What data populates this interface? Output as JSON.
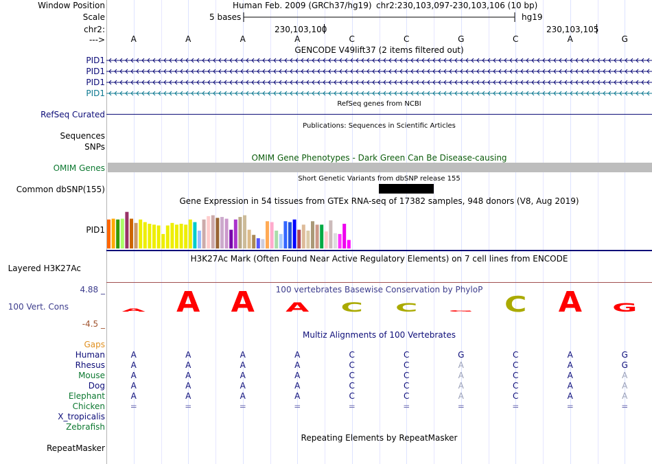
{
  "header": {
    "window_position_label": "Window Position",
    "scale_label": "Scale",
    "chrom_label": "chr2:",
    "arrow_label": "--->",
    "assembly": "Human Feb. 2009 (GRCh37/hg19)",
    "position": "chr2:230,103,097-230,103,106 (10 bp)",
    "scale_text": "5 bases",
    "db": "hg19",
    "coord1": "230,103,100",
    "coord2": "230,103,105"
  },
  "bases": [
    "A",
    "A",
    "A",
    "A",
    "C",
    "C",
    "G",
    "C",
    "A",
    "G"
  ],
  "gencode": {
    "title": "GENCODE V49lift37 (2 items filtered out)",
    "items": [
      "PID1",
      "PID1",
      "PID1",
      "PID1"
    ],
    "colors": [
      "#0c0c78",
      "#0c0c78",
      "#0c0c78",
      "#0c7890"
    ]
  },
  "refseq": {
    "label": "RefSeq Curated",
    "title": "RefSeq genes from NCBI"
  },
  "publications": {
    "title": "Publications: Sequences in Scientific Articles",
    "label1": "Sequences",
    "label2": "SNPs"
  },
  "omim": {
    "title": "OMIM Gene Phenotypes - Dark Green Can Be Disease-causing",
    "label": "OMIM Genes"
  },
  "dbsnp": {
    "title": "Short Genetic Variants from dbSNP release 155",
    "label": "Common dbSNP(155)"
  },
  "gtex": {
    "title": "Gene Expression in 54 tissues from GTEx RNA-seq of 17382 samples, 948 donors (V8, Aug 2019)",
    "label": "PID1",
    "values": [
      0.68,
      0.7,
      0.68,
      0.7,
      0.86,
      0.7,
      0.6,
      0.68,
      0.62,
      0.58,
      0.56,
      0.54,
      0.34,
      0.54,
      0.6,
      0.56,
      0.58,
      0.56,
      0.68,
      0.62,
      0.42,
      0.68,
      0.76,
      0.78,
      0.72,
      0.74,
      0.7,
      0.44,
      0.68,
      0.74,
      0.78,
      0.44,
      0.32,
      0.24,
      0.22,
      0.64,
      0.62,
      0.42,
      0.34,
      0.64,
      0.62,
      0.68,
      0.44,
      0.56,
      0.42,
      0.64,
      0.56,
      0.56,
      0.4,
      0.66,
      0.36,
      0.34,
      0.58,
      0.2
    ],
    "colors": [
      "#ff6600",
      "#ffaa00",
      "#339900",
      "#aaff66",
      "#993366",
      "#cc6600",
      "#cc9966",
      "#eeee00",
      "#eeee00",
      "#eeee00",
      "#eeee00",
      "#eeee00",
      "#eeee00",
      "#eeee00",
      "#eeee00",
      "#eeee00",
      "#eeee00",
      "#eeee00",
      "#eeee00",
      "#00cccc",
      "#99bbff",
      "#ccaaaa",
      "#ffcccc",
      "#ccaaaa",
      "#996633",
      "#ccaacc",
      "#cc99cc",
      "#7700aa",
      "#aa33cc",
      "#bbaa88",
      "#ccbb99",
      "#ddbb88",
      "#aa8855",
      "#5555ff",
      "#ccccdd",
      "#ffaa55",
      "#ffaacc",
      "#aaddaa",
      "#aaccff",
      "#3366ff",
      "#2255dd",
      "#0000ff",
      "#aa4455",
      "#ddbb99",
      "#ddccaa",
      "#aa9977",
      "#cc9988",
      "#00aa44",
      "#ffcccc",
      "#ccbbbb",
      "#dddddd",
      "#ff33ff",
      "#ee00ee",
      "#ff00ff"
    ]
  },
  "h3k27ac": {
    "title": "H3K27Ac Mark (Often Found Near Active Regulatory Elements) on 7 cell lines from ENCODE",
    "label": "Layered H3K27Ac"
  },
  "cons": {
    "title": "100 vertebrates Basewise Conservation by PhyloP",
    "label": "100 Vert. Cons",
    "max": "4.88 _",
    "min": "-4.5 _",
    "scores": [
      0.15,
      1.0,
      1.0,
      0.45,
      0.45,
      0.4,
      0.05,
      0.75,
      1.0,
      0.4
    ],
    "colors": [
      "#ff0000",
      "#ff0000",
      "#ff0000",
      "#ff0000",
      "#aaaa00",
      "#aaaa00",
      "#ff0000",
      "#aaaa00",
      "#ff0000",
      "#ff0000"
    ]
  },
  "multiz": {
    "title": "Multiz Alignments of 100 Vertebrates",
    "gaps_label": "Gaps",
    "species": [
      {
        "name": "Human",
        "bases": [
          "A",
          "A",
          "A",
          "A",
          "C",
          "C",
          "G",
          "C",
          "A",
          "G"
        ],
        "color": "#0c0c78"
      },
      {
        "name": "Rhesus",
        "bases": [
          "A",
          "A",
          "A",
          "A",
          "C",
          "C",
          "A",
          "C",
          "A",
          "G"
        ],
        "color": "#0c0c78"
      },
      {
        "name": "Mouse",
        "bases": [
          "A",
          "A",
          "A",
          "A",
          "C",
          "C",
          "A",
          "C",
          "A",
          "A"
        ],
        "color": "#0c7830"
      },
      {
        "name": "Dog",
        "bases": [
          "A",
          "A",
          "A",
          "A",
          "C",
          "C",
          "A",
          "C",
          "A",
          "A"
        ],
        "color": "#0c0c78"
      },
      {
        "name": "Elephant",
        "bases": [
          "A",
          "A",
          "A",
          "A",
          "C",
          "C",
          "A",
          "C",
          "A",
          "A"
        ],
        "color": "#0c7830"
      },
      {
        "name": "Chicken",
        "bases": [
          "=",
          "=",
          "=",
          "=",
          "=",
          "=",
          "=",
          "=",
          "=",
          "="
        ],
        "color": "#0c7830"
      },
      {
        "name": "X_tropicalis",
        "bases": [
          "",
          "",
          "",
          "",
          "",
          "",
          "",
          "",
          "",
          ""
        ],
        "color": "#0c0c78"
      },
      {
        "name": "Zebrafish",
        "bases": [
          "",
          "",
          "",
          "",
          "",
          "",
          "",
          "",
          "",
          ""
        ],
        "color": "#0c7830"
      }
    ]
  },
  "repeatmasker": {
    "title": "Repeating Elements by RepeatMasker",
    "label": "RepeatMasker"
  }
}
